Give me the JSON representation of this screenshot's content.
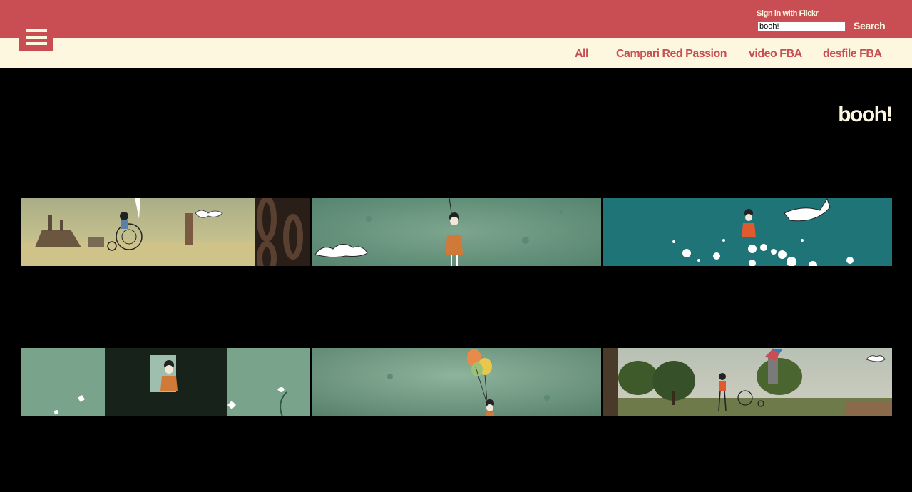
{
  "header": {
    "menu_icon": "hamburger-icon",
    "signin_label": "Sign in with Flickr",
    "search_value": "booh!",
    "search_button_label": "Search"
  },
  "nav": {
    "items": [
      {
        "label": "All"
      },
      {
        "label": "Campari Red Passion"
      },
      {
        "label": "video FBA"
      },
      {
        "label": "desfile FBA"
      }
    ]
  },
  "page": {
    "title": "booh!"
  },
  "gallery": {
    "thumbnails": [
      {
        "scene": "girl on penny-farthing bicycle by harbor with ships and giant chain"
      },
      {
        "scene": "girl holding string on green moon-like surface with cloud"
      },
      {
        "scene": "girl floating underwater with whale and bubbles on teal background"
      },
      {
        "scene": "girl looking through window in dark hedge with white flowers"
      },
      {
        "scene": "girl holding colored balloons on green surface"
      },
      {
        "scene": "boy with kite and penny-farthing bicycle in park with trees"
      }
    ]
  },
  "colors": {
    "header_red": "#c94e53",
    "cream": "#fdf7df",
    "background": "#000000",
    "search_focus": "#5b6fe0"
  }
}
